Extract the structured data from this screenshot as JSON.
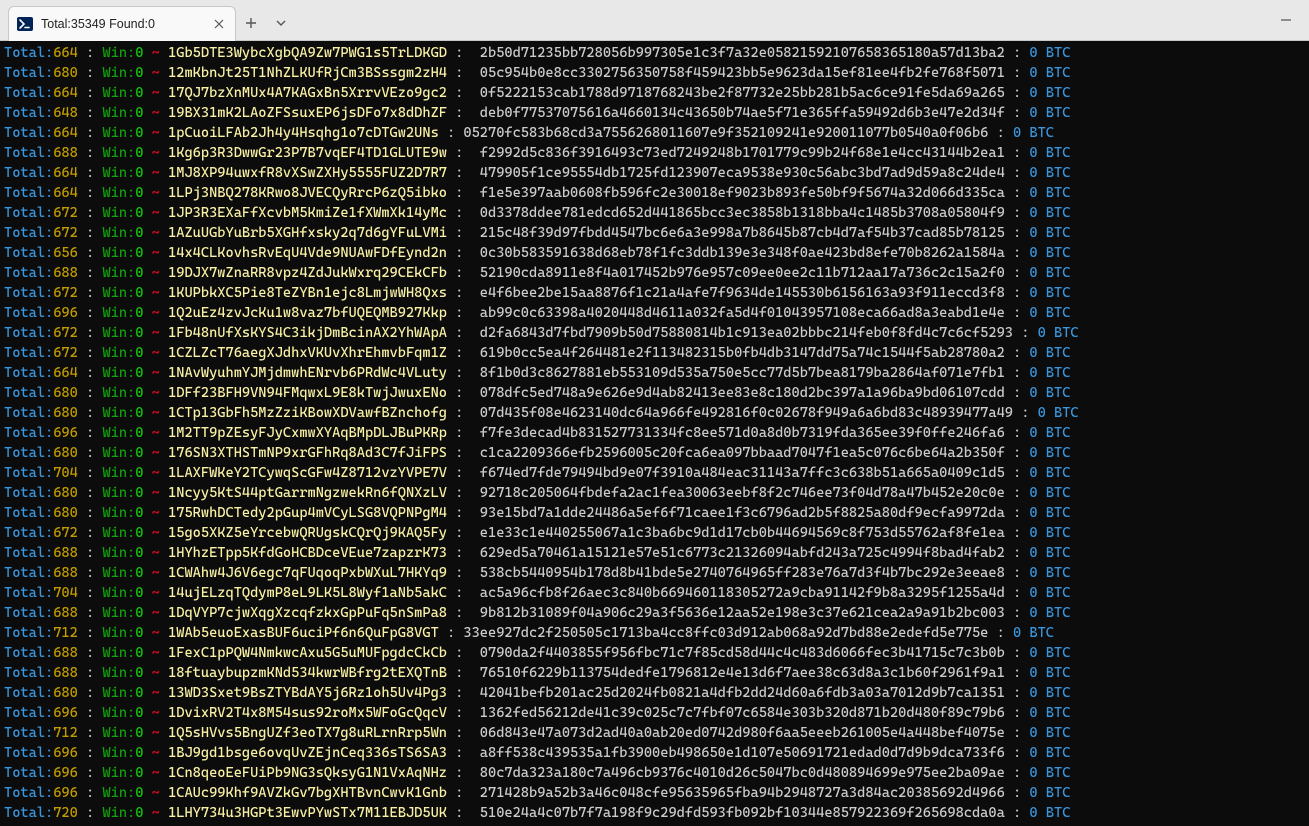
{
  "window": {
    "tab_title": "Total:35349 Found:0"
  },
  "rows": [
    {
      "total": 664,
      "addr": "1Gb5DTE3WybcXgbQA9Zw7PWG1s5TrLDKGD",
      "hash": "2b50d71235bb728056b997305e1c3f7a32e05821592107658365180a57d13ba2"
    },
    {
      "total": 680,
      "addr": "12mKbnJt25T1NhZLKUfRjCm3BSssgm2zH4",
      "hash": "05c954b0e8cc3302756350758f459423bb5e9623da15ef81ee4fb2fe768f5071"
    },
    {
      "total": 664,
      "addr": "17QJ7bzXnMUx4A7KAGxBn5XrrvVEzo9gc2",
      "hash": "0f5222153cab1788d9718768243be2f87732e25bb281b5ac6ce91fe5da69a265"
    },
    {
      "total": 648,
      "addr": "19BX31mK2LAoZFSsuxEP6jsDFo7x8dDhZF",
      "hash": "deb0f77537075616a4660134c43650b74ae5f71e365ffa59492d6b3e47e2d34f"
    },
    {
      "total": 664,
      "addr": "1pCuoiLFAb2Jh4y4Hsqhg1o7cDTGw2UNs",
      "hash": "05270fc583b68cd3a7556268011607e9f352109241e920011077b0540a0f06b6",
      "short": true
    },
    {
      "total": 688,
      "addr": "1Kg6p3R3DwwGr23P7B7vqEF4TD1GLUTE9w",
      "hash": "f2992d5c836f3916493c73ed7249248b1701779c99b24f68e1e4cc43144b2ea1"
    },
    {
      "total": 664,
      "addr": "1MJ8XP94uwxfR8vXSwZXHy5555FUZ2D7R7",
      "hash": "479905f1ce95554db1725fd123907eca9538e930c56abc3bd7ad9d59a8c24de4"
    },
    {
      "total": 664,
      "addr": "1LPj3NBQ278KRwo8JVECQyRrcP6zQ5ibko",
      "hash": "f1e5e397aab0608fb596fc2e30018ef9023b893fe50bf9f5674a32d066d335ca"
    },
    {
      "total": 672,
      "addr": "1JP3R3EXaFfXcvbM5KmiZe1fXWmXk14yMc",
      "hash": "0d3378ddee781edcd652d441865bcc3ec3858b1318bba4c1485b3708a05804f9"
    },
    {
      "total": 672,
      "addr": "1AZuUGbYuBrb5XGHfxsky2q7d6gYFuLVMi",
      "hash": "215c48f39d97fbdd4547bc6e6a3e998a7b8645b87cb4d7af54b37cad85b78125"
    },
    {
      "total": 656,
      "addr": "14x4CLKovhsRvEqU4Vde9NUAwFDfEynd2n",
      "hash": "0c30b583591638d68eb78f1fc3ddb139e3e348f0ae423bd8efe70b8262a1584a"
    },
    {
      "total": 688,
      "addr": "19DJX7wZnaRR8vpz4ZdJukWxrq29CEkCFb",
      "hash": "52190cda8911e8f4a017452b976e957c09ee0ee2c11b712aa17a736c2c15a2f0"
    },
    {
      "total": 672,
      "addr": "1KUPbkXC5Pie8TeZYBn1ejc8LmjwWH8Qxs",
      "hash": "e4f6bee2be15aa8876f1c21a4afe7f9634de145530b6156163a93f911eccd3f8"
    },
    {
      "total": 696,
      "addr": "1Q2uEz4zvJcKu1w8vaz7bfUQEQMB927Kkp",
      "hash": "ab99c0c63398a4020448d4611a032fa5d4f01043957108eca66ad8a3eabd1e4e"
    },
    {
      "total": 672,
      "addr": "1Fb48nUfXsKYS4C3ikjDmBcinAX2YhWApA",
      "hash": "d2fa6843d7fbd7909b50d75880814b1c913ea02bbbc214feb0f8fd4c7c6cf5293"
    },
    {
      "total": 672,
      "addr": "1CZLZcT76aegXJdhxVKUvXhrEhmvbFqm1Z",
      "hash": "619b0cc5ea4f264481e2f113482315b0fb4db3147dd75a74c1544f5ab28780a2"
    },
    {
      "total": 664,
      "addr": "1NAvWyuhmYJMjdmwhENrvb6PRdWc4VLuty",
      "hash": "8f1b0d3c8627881eb553109d535a750e5cc77d5b7bea8179ba2864af071e7fb1"
    },
    {
      "total": 680,
      "addr": "1DFf23BFH9VN94FMqwxL9E8kTwjJwuxENo",
      "hash": "078dfc5ed748a9e626e9d4ab82413ee83e8c180d2bc397a1a96ba9bd06107cdd"
    },
    {
      "total": 680,
      "addr": "1CTp13GbFh5MzZziKBowXDVawfBZnchofg",
      "hash": "07d435f08e4623140dc64a966fe492816f0c02678f949a6a6bd83c48939477a49"
    },
    {
      "total": 696,
      "addr": "1M2TT9pZEsyFJyCxmwXYAqBMpDLJBuPKRp",
      "hash": "f7fe3decad4b831527731334fc8ee571d0a8d0b7319fda365ee39f0ffe246fa6"
    },
    {
      "total": 680,
      "addr": "176SN3XTHSTmNP9xrGFhRq8Ad3C7fJiFPS",
      "hash": "c1ca2209366efb2596005c20fca6ea097bbaad7047f1ea5c076c6be64a2b350f"
    },
    {
      "total": 704,
      "addr": "1LAXFWKeY2TCywqScGFw4Z8712vzYVPE7V",
      "hash": "f674ed7fde79494bd9e07f3910a484eac31143a7ffc3c638b51a665a0409c1d5"
    },
    {
      "total": 680,
      "addr": "1Ncyy5KtS44ptGarrmNgzwekRn6fQNXzLV",
      "hash": "92718c205064fbdefa2ac1fea30063eebf8f2c746ee73f04d78a47b452e20c0e"
    },
    {
      "total": 680,
      "addr": "175RwhDCTedy2pGup4mVCyLSG8VQPNPgM4",
      "hash": "93e15bd7a1dde24486a5ef6f71caee1f3c6796ad2b5f8825a80df9ecfa9972da"
    },
    {
      "total": 672,
      "addr": "15go5XKZ5eYrcebwQRUgskCQrQj9KAQ5Fy",
      "hash": "e1e33c1e440255067a1c3ba6bc9d1d17cb0b44694569c8f753d55762af8fe1ea"
    },
    {
      "total": 688,
      "addr": "1HYhzETpp5KfdGoHCBDceVEue7zapzrK73",
      "hash": "629ed5a70461a15121e57e51c6773c21326094abfd243a725c4994f8bad4fab2"
    },
    {
      "total": 688,
      "addr": "1CWAhw4J6V6egc7qFUqoqPxbWXuL7HKYq9",
      "hash": "538cb5440954b178d8b41bde5e2740764965ff283e76a7d3f4b7bc292e3eeae8"
    },
    {
      "total": 704,
      "addr": "14ujELzqTQdymP8eL9LK5L8Wyf1aNb5akC",
      "hash": "ac5a96cfb8f26aec3c840b669460118305272a9cba91142f9b8a3295f1255a4d"
    },
    {
      "total": 688,
      "addr": "1DqVYP7cjwXqgXzcqfzkxGpPuFq5nSmPa8",
      "hash": "9b812b31089f04a906c29a3f5636e12aa52e198e3c37e621cea2a9a91b2bc003"
    },
    {
      "total": 712,
      "addr": "1WAb5euoExasBUF6uciPf6n6QuFpG8VGT",
      "hash": "33ee927dc2f250505c1713ba4cc8ffc03d912ab068a92d7bd88e2edefd5e775e",
      "short": true
    },
    {
      "total": 688,
      "addr": "1FexC1pPQW4NmkwcAxu5G5uMUFpgdcCkCb",
      "hash": "0790da2f4403855f956fbc71c7f85cd58d44c4c483d6066fec3b41715c7c3b0b"
    },
    {
      "total": 688,
      "addr": "18ftuaybupzmKNd534kwrWBfrg2tEXQTnB",
      "hash": "76510f6229b113754dedfe1796812e4e13d6f7aee38c63d8a3c1b60f2961f9a1"
    },
    {
      "total": 680,
      "addr": "13WD3Sxet9BsZTYBdAY5j6Rz1oh5Uv4Pg3",
      "hash": "42041befb201ac25d2024fb0821a4dfb2dd24d60a6fdb3a03a7012d9b7ca1351"
    },
    {
      "total": 696,
      "addr": "1DvixRV2T4x8M54sus92roMx5WFoGcQqcV",
      "hash": "1362fed56212de41c39c025c7c7fbf07c6584e303b320d871b20d480f89c79b6"
    },
    {
      "total": 712,
      "addr": "1Q5sHVvs5BngUZf3eoTX7g8uRLrnRrp5Wn",
      "hash": "06d843e47a073d2ad40a0ab20ed0742d980f6aa5eeeb261005e4a448bef4075e"
    },
    {
      "total": 696,
      "addr": "1BJ9gd1bsge6ovqUvZEjnCeq336sTS6SA3",
      "hash": "a8ff538c439535a1fb3900eb498650e1d107e50691721edad0d7d9b9dca733f6"
    },
    {
      "total": 696,
      "addr": "1Cn8qeoEeFUiPb9NG3sQksyG1N1VxAqNHz",
      "hash": "80c7da323a180c7a496cb9376c4010d26c5047bc0d480894699e975ee2ba09ae"
    },
    {
      "total": 696,
      "addr": "1CAUc99Khf9AVZkGv7bgXHTBvnCwvK1Gnb",
      "hash": "271428b9a52b3a46c048cfe95635965fba94b2948727a3d84ac20385692d4966"
    },
    {
      "total": 720,
      "addr": "1LHY734u3HGPt3EwvPYwSTx7M11EBJD5UK",
      "hash": "510e24a4c07b7f7a198f9c29dfd593fb092bf10344e857922369f265698cda0a"
    }
  ],
  "labels": {
    "total_prefix": "Total:",
    "win_prefix": "Win:",
    "win_value": "0",
    "tilde": "~",
    "colon": " : ",
    "balance_value": "0",
    "currency": "BTC"
  }
}
